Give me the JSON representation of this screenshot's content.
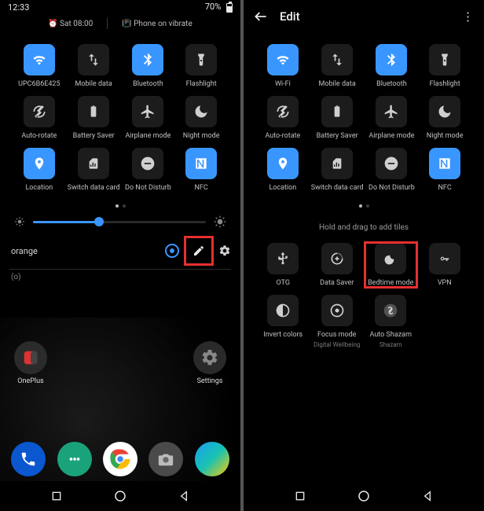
{
  "left": {
    "status": {
      "time": "12:33",
      "battery": "70%"
    },
    "header": {
      "alarm": "Sat 08:00",
      "ringer": "Phone on vibrate"
    },
    "tiles": [
      {
        "id": "wifi",
        "label": "UPC6B6E425",
        "active": true,
        "icon": "wifi"
      },
      {
        "id": "mobile-data",
        "label": "Mobile data",
        "active": false,
        "icon": "swap"
      },
      {
        "id": "bluetooth",
        "label": "Bluetooth",
        "active": true,
        "icon": "bluetooth"
      },
      {
        "id": "flashlight",
        "label": "Flashlight",
        "active": false,
        "icon": "flashlight"
      },
      {
        "id": "auto-rotate",
        "label": "Auto-rotate",
        "active": false,
        "icon": "rotate"
      },
      {
        "id": "battery-saver",
        "label": "Battery Saver",
        "active": false,
        "icon": "battery"
      },
      {
        "id": "airplane",
        "label": "Airplane mode",
        "active": false,
        "icon": "plane"
      },
      {
        "id": "night-mode",
        "label": "Night mode",
        "active": false,
        "icon": "moon"
      },
      {
        "id": "location",
        "label": "Location",
        "active": true,
        "icon": "location"
      },
      {
        "id": "switch-data",
        "label": "Switch data card",
        "active": false,
        "icon": "sim"
      },
      {
        "id": "dnd",
        "label": "Do Not Disturb",
        "active": false,
        "icon": "dnd"
      },
      {
        "id": "nfc",
        "label": "NFC",
        "active": true,
        "icon": "nfc"
      }
    ],
    "brightness_pct": 38,
    "carrier": "orange",
    "sim_sub": "(o)",
    "apps": {
      "a1": "OnePlus",
      "a2": "Settings"
    }
  },
  "right": {
    "title": "Edit",
    "tiles": [
      {
        "id": "wifi",
        "label": "Wi-Fi",
        "active": true,
        "icon": "wifi"
      },
      {
        "id": "mobile-data",
        "label": "Mobile data",
        "active": false,
        "icon": "swap"
      },
      {
        "id": "bluetooth",
        "label": "Bluetooth",
        "active": true,
        "icon": "bluetooth"
      },
      {
        "id": "flashlight",
        "label": "Flashlight",
        "active": false,
        "icon": "flashlight"
      },
      {
        "id": "auto-rotate",
        "label": "Auto-rotate",
        "active": false,
        "icon": "rotate"
      },
      {
        "id": "battery-saver",
        "label": "Battery Saver",
        "active": false,
        "icon": "battery"
      },
      {
        "id": "airplane",
        "label": "Airplane mode",
        "active": false,
        "icon": "plane"
      },
      {
        "id": "night-mode",
        "label": "Night mode",
        "active": false,
        "icon": "moon"
      },
      {
        "id": "location",
        "label": "Location",
        "active": true,
        "icon": "location"
      },
      {
        "id": "switch-data",
        "label": "Switch data card",
        "active": false,
        "icon": "sim"
      },
      {
        "id": "dnd",
        "label": "Do Not Disturb",
        "active": false,
        "icon": "dnd"
      },
      {
        "id": "nfc",
        "label": "NFC",
        "active": true,
        "icon": "nfc"
      }
    ],
    "hint": "Hold and drag to add tiles",
    "extras": [
      {
        "id": "otg",
        "label": "OTG",
        "sub": "",
        "icon": "usb"
      },
      {
        "id": "data-saver",
        "label": "Data Saver",
        "sub": "",
        "icon": "datasaver"
      },
      {
        "id": "bedtime",
        "label": "Bedtime mode",
        "sub": "",
        "icon": "bedtime",
        "highlight": true
      },
      {
        "id": "vpn",
        "label": "VPN",
        "sub": "",
        "icon": "key"
      },
      {
        "id": "invert",
        "label": "Invert colors",
        "sub": "",
        "icon": "invert"
      },
      {
        "id": "focus",
        "label": "Focus mode",
        "sub": "Digital Wellbeing",
        "icon": "focus"
      },
      {
        "id": "shazam",
        "label": "Auto Shazam",
        "sub": "Shazam",
        "icon": "shazam"
      }
    ]
  }
}
